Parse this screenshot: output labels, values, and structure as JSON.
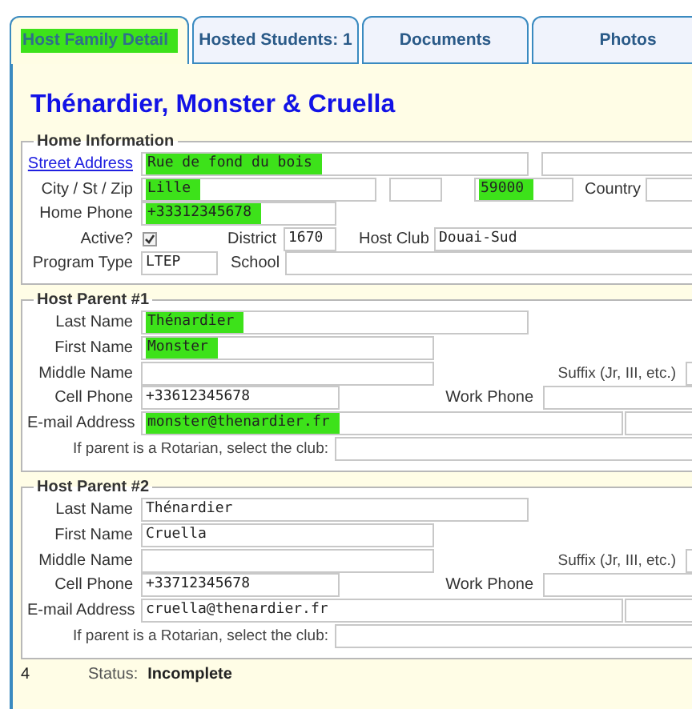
{
  "tabs": [
    {
      "label": "Host Family Detail",
      "selected": true,
      "highlighted": true
    },
    {
      "label": "Hosted Students: 1",
      "selected": false,
      "highlighted": false
    },
    {
      "label": "Documents",
      "selected": false,
      "highlighted": false
    },
    {
      "label": "Photos",
      "selected": false,
      "highlighted": false
    }
  ],
  "title": "Thénardier, Monster & Cruella",
  "home_information": {
    "legend": "Home Information",
    "street_address": {
      "label": "Street Address",
      "value": "Rue de fond du bois",
      "highlighted": true
    },
    "city_st_zip": {
      "label": "City / St / Zip",
      "city": {
        "value": "Lille",
        "highlighted": true
      },
      "zip": {
        "value": "59000",
        "highlighted": true
      }
    },
    "country": {
      "label": "Country"
    },
    "home_phone": {
      "label": "Home Phone",
      "value": "+33312345678",
      "highlighted": true
    },
    "active": {
      "label": "Active?",
      "checked": true
    },
    "district": {
      "label": "District",
      "value": "1670"
    },
    "host_club": {
      "label": "Host Club",
      "value": "Douai-Sud"
    },
    "program_type": {
      "label": "Program Type",
      "value": "LTEP"
    },
    "school": {
      "label": "School"
    }
  },
  "host_parents": [
    {
      "legend": "Host Parent #1",
      "last_name": {
        "label": "Last Name",
        "value": "Thénardier",
        "highlighted": true
      },
      "first_name": {
        "label": "First Name",
        "value": "Monster",
        "highlighted": true
      },
      "middle_name": {
        "label": "Middle Name"
      },
      "suffix": {
        "label": "Suffix (Jr, III, etc.)"
      },
      "cell_phone": {
        "label": "Cell Phone",
        "value": "+33612345678",
        "highlighted": false
      },
      "work_phone": {
        "label": "Work Phone"
      },
      "email": {
        "label": "E-mail Address",
        "value": "monster@thenardier.fr",
        "highlighted": true
      },
      "rotarian_club": {
        "label": "If parent is a Rotarian, select the club:"
      }
    },
    {
      "legend": "Host Parent #2",
      "last_name": {
        "label": "Last Name",
        "value": "Thénardier",
        "highlighted": false
      },
      "first_name": {
        "label": "First Name",
        "value": "Cruella",
        "highlighted": false
      },
      "middle_name": {
        "label": "Middle Name"
      },
      "suffix": {
        "label": "Suffix (Jr, III, etc.)"
      },
      "cell_phone": {
        "label": "Cell Phone",
        "value": "+33712345678",
        "highlighted": false
      },
      "work_phone": {
        "label": "Work Phone"
      },
      "email": {
        "label": "E-mail Address",
        "value": "cruella@thenardier.fr",
        "highlighted": false
      },
      "rotarian_club": {
        "label": "If parent is a Rotarian, select the club:"
      }
    }
  ],
  "footer": {
    "number": "4",
    "status_label": "Status:",
    "status": "Incomplete"
  }
}
